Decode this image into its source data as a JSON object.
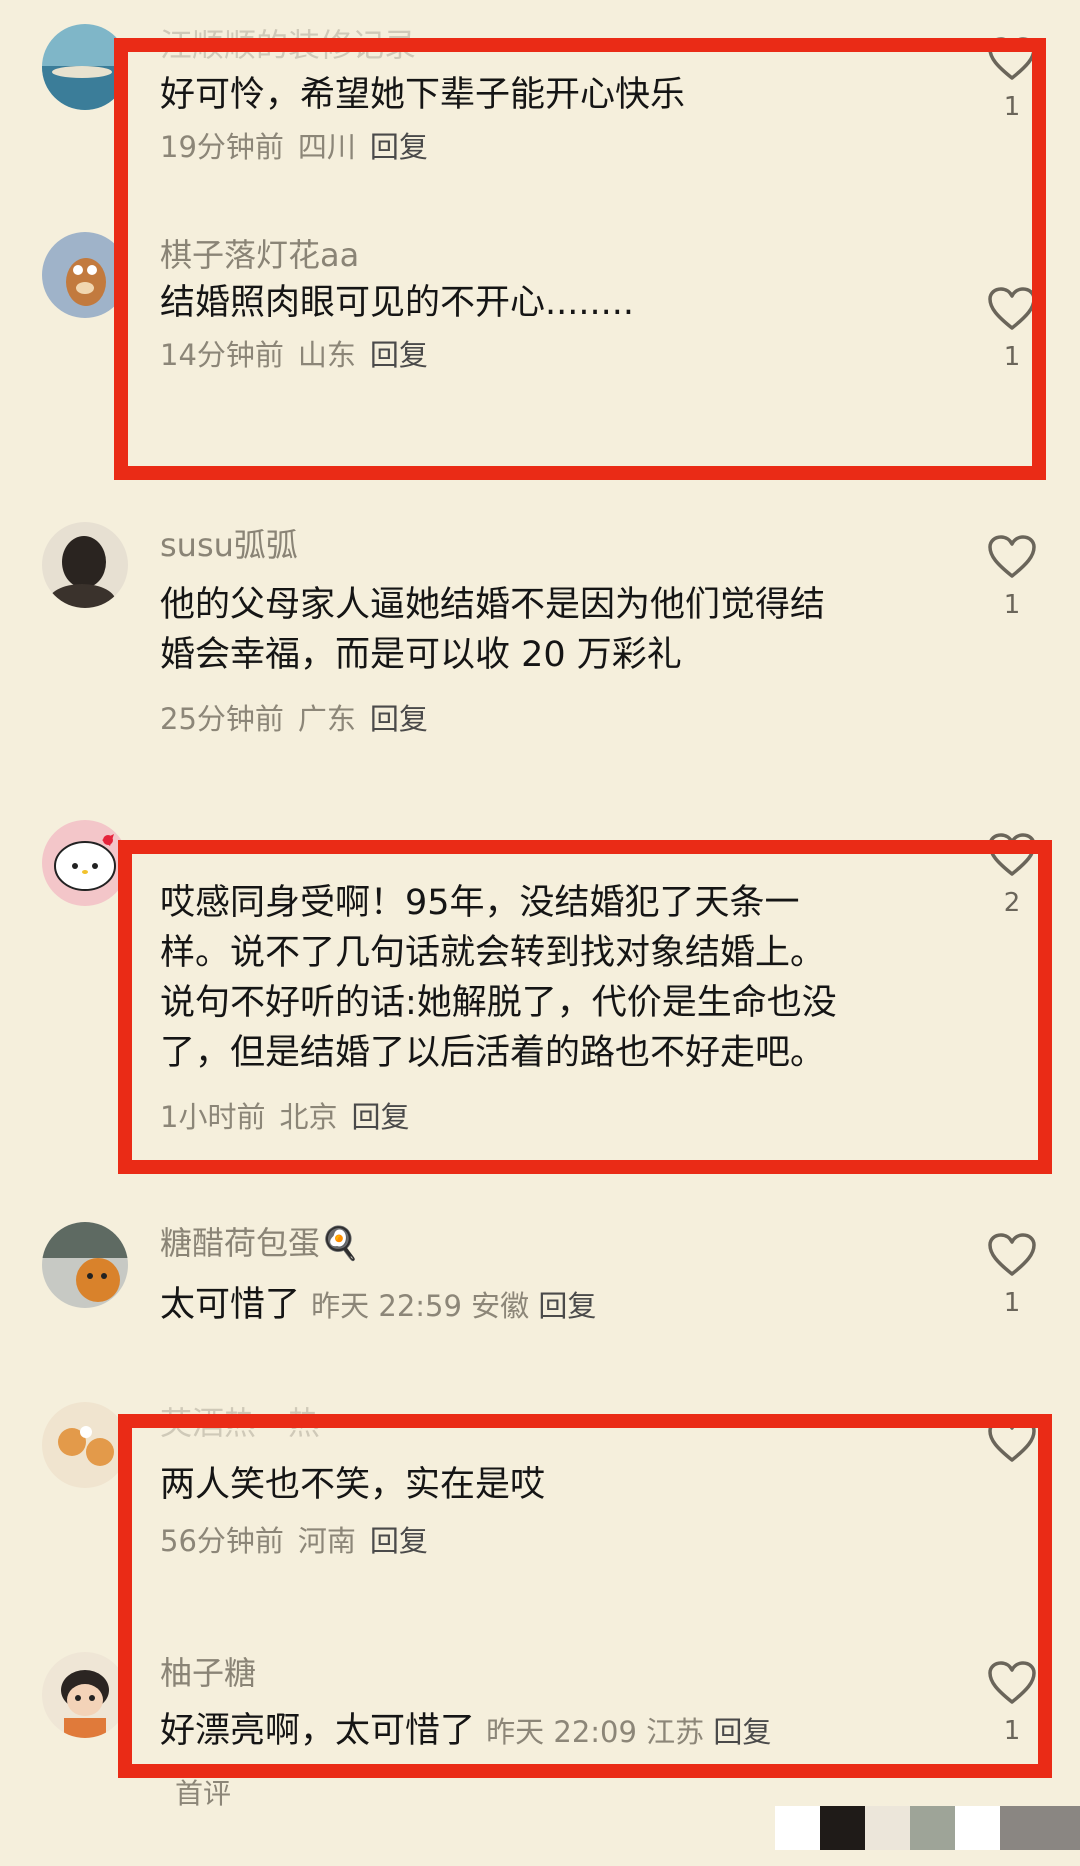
{
  "comments": [
    {
      "name": "汪顺顺的装修记录",
      "text": "好可怜，希望她下辈子能开心快乐",
      "time": "19分钟前",
      "location": "四川",
      "reply": "回复",
      "likes": "1"
    },
    {
      "name": "棋子落灯花aa",
      "text": "结婚照肉眼可见的不开心........",
      "time": "14分钟前",
      "location": "山东",
      "reply": "回复",
      "likes": "1"
    },
    {
      "name": "susu弧弧",
      "text": "他的父母家人逼她结婚不是因为他们觉得结\n婚会幸福，而是可以收 20 万彩礼",
      "time": "25分钟前",
      "location": "广东",
      "reply": "回复",
      "likes": "1"
    },
    {
      "name": "",
      "text": "哎感同身受啊！95年，没结婚犯了天条一\n样。说不了几句话就会转到找对象结婚上。\n说句不好听的话:她解脱了，代价是生命也没\n了，但是结婚了以后活着的路也不好走吧。",
      "time": "1小时前",
      "location": "北京",
      "reply": "回复",
      "likes": "2"
    },
    {
      "name": "糖醋荷包蛋🍳",
      "text": "太可惜了",
      "time": "昨天 22:59",
      "location": "安徽",
      "reply": "回复",
      "likes": "1"
    },
    {
      "name": "芙酒热一热",
      "text": "两人笑也不笑，实在是哎",
      "time": "56分钟前",
      "location": "河南",
      "reply": "回复",
      "likes": ""
    },
    {
      "name": "柚子糖",
      "text": "好漂亮啊，太可惜了",
      "time": "昨天 22:09",
      "location": "江苏",
      "reply": "回复",
      "likes": "1"
    }
  ],
  "footer_text": "首评",
  "colors": {
    "background": "#f5efdc",
    "highlight_border": "#ea2b16"
  }
}
